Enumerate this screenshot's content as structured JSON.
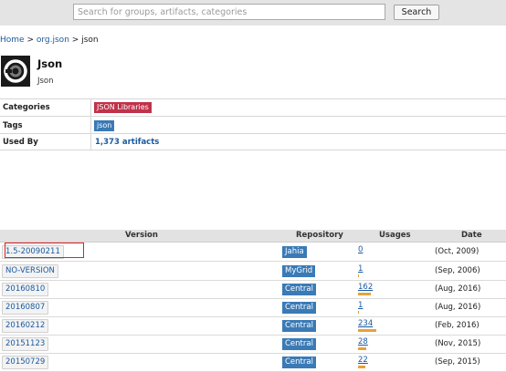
{
  "search": {
    "placeholder": "Search for groups, artifacts, categories",
    "button_label": "Search"
  },
  "breadcrumb": {
    "home": "Home",
    "group": "org.json",
    "separator": ">",
    "current": "json"
  },
  "artifact": {
    "title": "Json",
    "subtitle": "Json",
    "logo_icon": "json-logo-icon"
  },
  "meta": {
    "categories_label": "Categories",
    "categories_value": "JSON Libraries",
    "tags_label": "Tags",
    "tags_value": "json",
    "used_by_label": "Used By",
    "used_by_value": "1,373 artifacts"
  },
  "colors": {
    "accent_link": "#1a5aa0",
    "category_tag": "#c0324a",
    "repo_tag": "#3a7ab6",
    "usage_bar": "#e6a23c",
    "highlight_box": "#e02020"
  },
  "versions_table": {
    "headers": {
      "version": "Version",
      "repository": "Repository",
      "usages": "Usages",
      "date": "Date"
    },
    "rows": [
      {
        "version": "1.5-20090211",
        "repository": "Jahia",
        "usages": "0",
        "usage_fraction": 0.0,
        "date": "(Oct, 2009)",
        "highlighted": true
      },
      {
        "version": "NO-VERSION",
        "repository": "MyGrid",
        "usages": "1",
        "usage_fraction": 0.05,
        "date": "(Sep, 2006)"
      },
      {
        "version": "20160810",
        "repository": "Central",
        "usages": "162",
        "usage_fraction": 0.69,
        "date": "(Aug, 2016)"
      },
      {
        "version": "20160807",
        "repository": "Central",
        "usages": "1",
        "usage_fraction": 0.05,
        "date": "(Aug, 2016)"
      },
      {
        "version": "20160212",
        "repository": "Central",
        "usages": "234",
        "usage_fraction": 1.0,
        "date": "(Feb, 2016)"
      },
      {
        "version": "20151123",
        "repository": "Central",
        "usages": "28",
        "usage_fraction": 0.45,
        "date": "(Nov, 2015)"
      },
      {
        "version": "20150729",
        "repository": "Central",
        "usages": "22",
        "usage_fraction": 0.4,
        "date": "(Sep, 2015)"
      }
    ]
  }
}
